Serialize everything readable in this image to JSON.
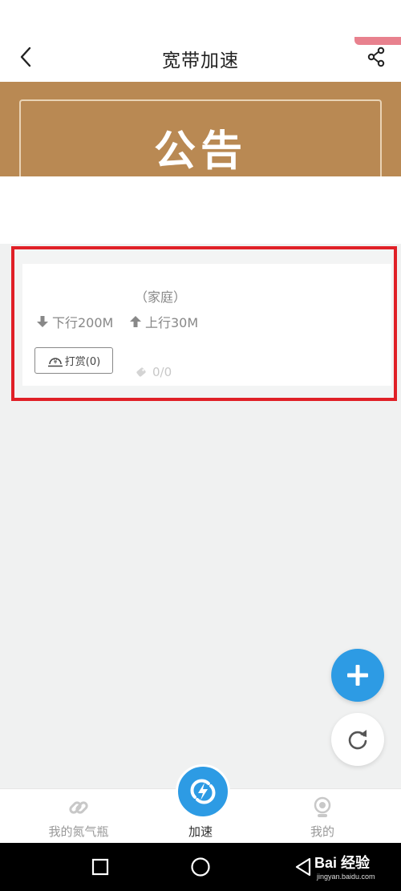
{
  "header": {
    "title": "宽带加速",
    "back_icon": "chevron-left-icon",
    "share_icon": "share-icon"
  },
  "banner": {
    "title": "公告",
    "color": "#b98953"
  },
  "plan_card": {
    "type_label": "（家庭）",
    "download": "下行200M",
    "upload": "上行30M",
    "tip_button": "打赏(0)",
    "usage_count": "0/0"
  },
  "fab": {
    "add_icon": "plus-icon",
    "refresh_icon": "refresh-icon",
    "accent": "#2d9be4"
  },
  "tabbar": {
    "tabs": [
      {
        "label": "我的氮气瓶",
        "icon": "link-icon",
        "active": false
      },
      {
        "label": "加速",
        "icon": "bolt-icon",
        "active": true
      },
      {
        "label": "我的",
        "icon": "profile-icon",
        "active": false
      }
    ]
  },
  "watermark": {
    "brand": "Bai 经验",
    "url": "jingyan.baidu.com"
  },
  "highlight_color": "#e02027"
}
